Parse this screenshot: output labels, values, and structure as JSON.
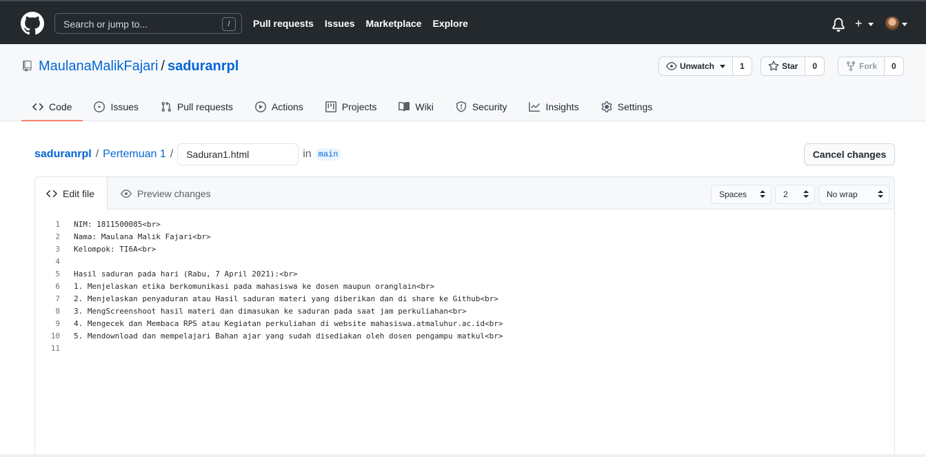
{
  "header": {
    "search_placeholder": "Search or jump to...",
    "search_shortcut": "/",
    "nav": [
      "Pull requests",
      "Issues",
      "Marketplace",
      "Explore"
    ]
  },
  "repo": {
    "owner": "MaulanaMalikFajari",
    "separator": "/",
    "name": "saduranrpl",
    "watch": {
      "label": "Unwatch",
      "count": "1"
    },
    "star": {
      "label": "Star",
      "count": "0"
    },
    "fork": {
      "label": "Fork",
      "count": "0"
    }
  },
  "tabs": [
    {
      "label": "Code",
      "icon": "code-icon"
    },
    {
      "label": "Issues",
      "icon": "issue-icon"
    },
    {
      "label": "Pull requests",
      "icon": "pull-request-icon"
    },
    {
      "label": "Actions",
      "icon": "play-icon"
    },
    {
      "label": "Projects",
      "icon": "project-icon"
    },
    {
      "label": "Wiki",
      "icon": "book-icon"
    },
    {
      "label": "Security",
      "icon": "shield-icon"
    },
    {
      "label": "Insights",
      "icon": "graph-icon"
    },
    {
      "label": "Settings",
      "icon": "gear-icon"
    }
  ],
  "breadcrumb": {
    "root": "saduranrpl",
    "folder": "Pertemuan 1",
    "filename": "Saduran1.html",
    "in_text": "in",
    "branch": "main"
  },
  "cancel_label": "Cancel changes",
  "editor": {
    "edit_tab": "Edit file",
    "preview_tab": "Preview changes",
    "indent_mode": "Spaces",
    "indent_size": "2",
    "wrap_mode": "No wrap",
    "lines": [
      {
        "n": "1",
        "text": "NIM: 1811500085<br>"
      },
      {
        "n": "2",
        "text": "Nama: Maulana Malik Fajari<br>"
      },
      {
        "n": "3",
        "text": "Kelompok: TI6A<br>"
      },
      {
        "n": "4",
        "text": ""
      },
      {
        "n": "5",
        "text": "Hasil saduran pada hari (Rabu, 7 April 2021):<br>"
      },
      {
        "n": "6",
        "text": "1. Menjelaskan etika berkomunikasi pada mahasiswa ke dosen maupun oranglain<br>"
      },
      {
        "n": "7",
        "text": "2. Menjelaskan penyaduran atau Hasil saduran materi yang diberikan dan di share ke Github<br>"
      },
      {
        "n": "8",
        "text": "3. MengScreenshoot hasil materi dan dimasukan ke saduran pada saat jam perkuliahan<br>"
      },
      {
        "n": "9",
        "text": "4. Mengecek dan Membaca RPS atau Kegiatan perkuliahan di website mahasiswa.atmaluhur.ac.id<br>"
      },
      {
        "n": "10",
        "text": "5. Mendownload dan mempelajari Bahan ajar yang sudah disediakan oleh dosen pengampu matkul<br>"
      },
      {
        "n": "11",
        "text": ""
      }
    ]
  }
}
